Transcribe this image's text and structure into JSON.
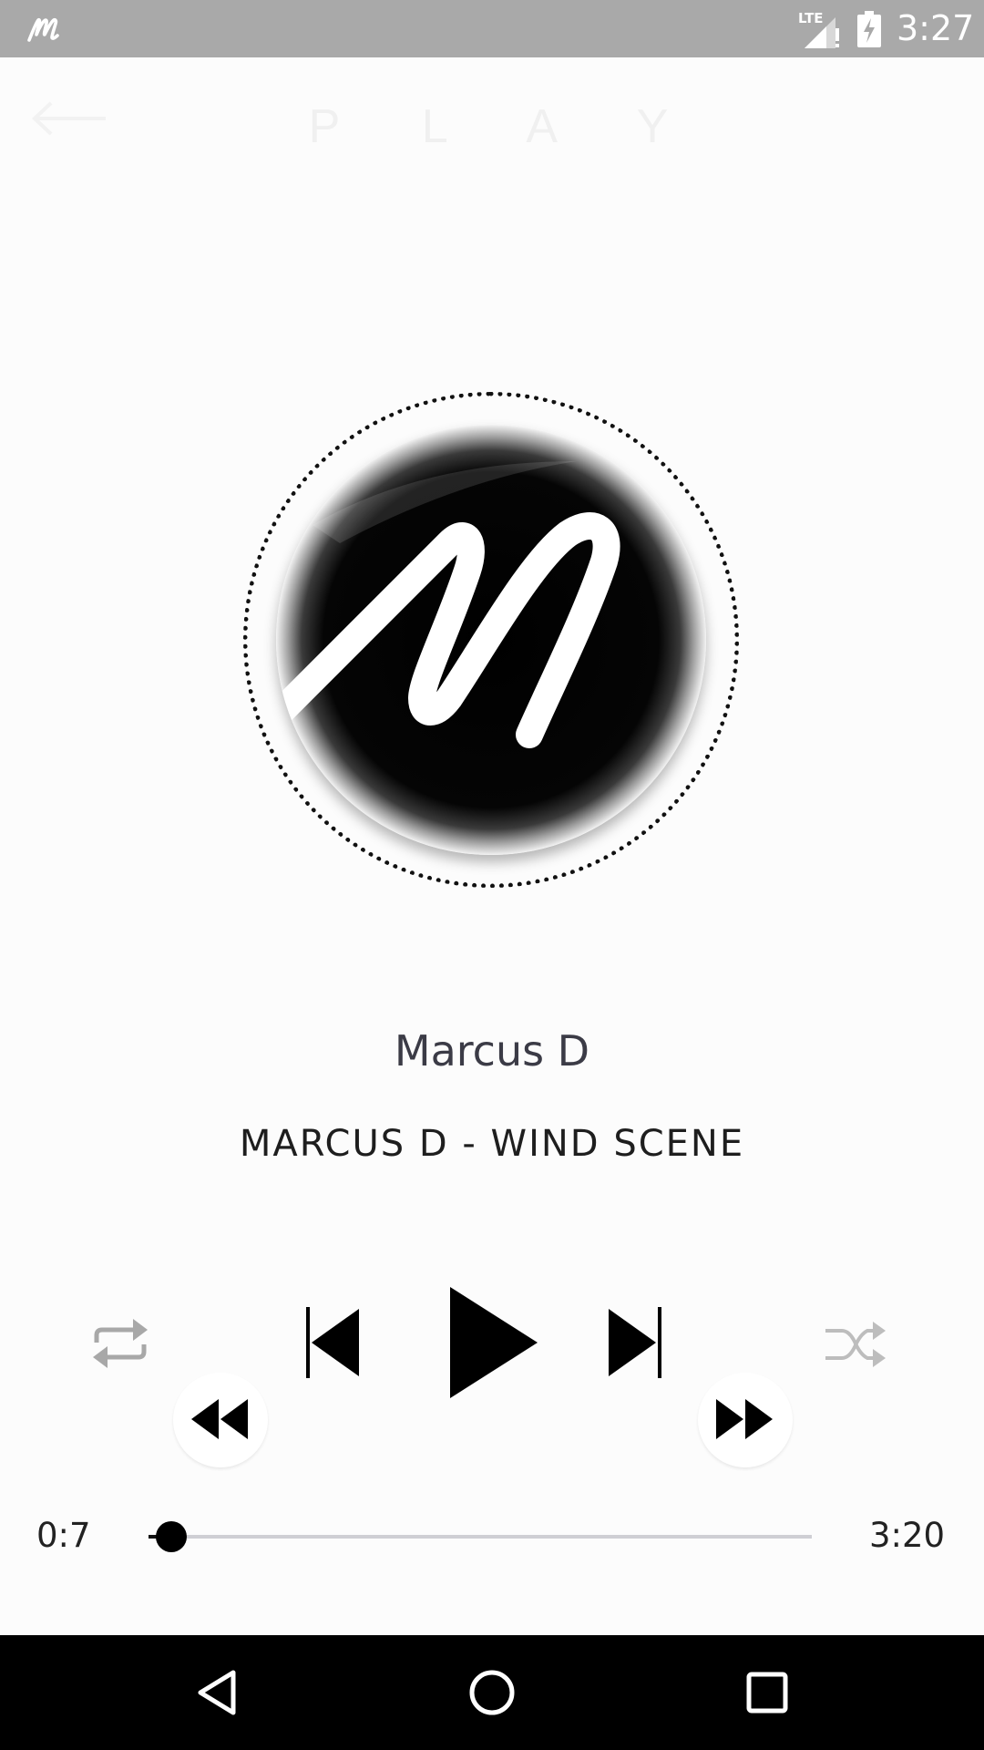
{
  "status_bar": {
    "network": "LTE",
    "time": "3:27",
    "icons": [
      "app-logo-icon",
      "lte-signal-icon",
      "battery-charging-icon"
    ]
  },
  "app_bar": {
    "title": "P L A Y",
    "back_icon": "arrow-left-icon"
  },
  "artwork": {
    "logo_letter": "M",
    "ring_style": "dotted"
  },
  "now_playing": {
    "artist": "Marcus D",
    "track": "MARCUS D - WIND SCENE"
  },
  "controls": {
    "icons": [
      "repeat-icon",
      "skip-previous-icon",
      "play-icon",
      "skip-next-icon",
      "shuffle-icon",
      "rewind-icon",
      "fast-forward-icon"
    ]
  },
  "progress": {
    "elapsed": "0:7",
    "total": "3:20",
    "fraction": 0.035
  },
  "nav_bar": {
    "icons": [
      "back-triangle-icon",
      "home-circle-icon",
      "recents-square-icon"
    ]
  },
  "colors": {
    "status_bar": "#a9a9a9",
    "background": "#fcfcfc",
    "controls_active": "#000000",
    "controls_inactive": "#a8a8a8",
    "seek_track": "#cfcfd4",
    "nav_bar": "#000000"
  }
}
